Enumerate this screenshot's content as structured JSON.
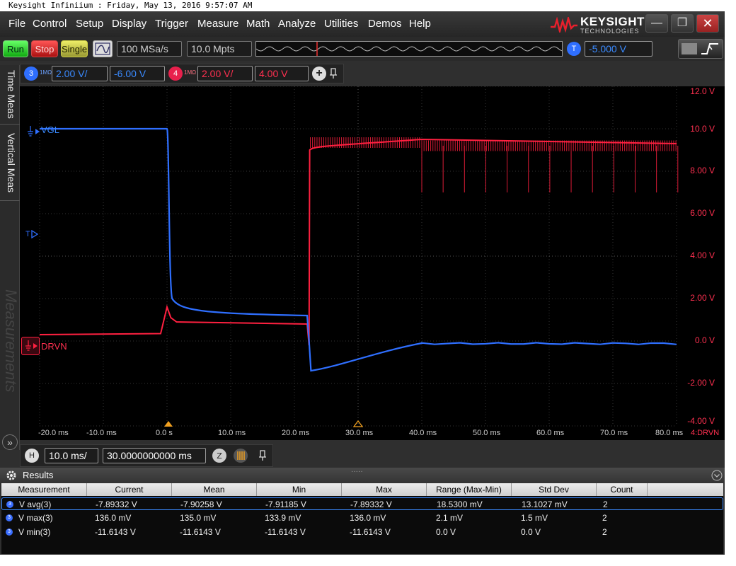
{
  "title_bar": "Keysight Infiniium : Friday, May 13, 2016 9:57:07 AM",
  "menu": [
    "File",
    "Control",
    "Setup",
    "Display",
    "Trigger",
    "Measure",
    "Math",
    "Analyze",
    "Utilities",
    "Demos",
    "Help"
  ],
  "logo": {
    "name": "KEYSIGHT",
    "sub": "TECHNOLOGIES"
  },
  "window_buttons": {
    "minimize": "—",
    "maximize": "❐",
    "close": "✕"
  },
  "toolbar": {
    "run": "Run",
    "stop": "Stop",
    "single": "Single",
    "sample_rate": "100 MSa/s",
    "memory_depth": "10.0 Mpts",
    "trigger_badge": "T",
    "trigger_level": "-5.000 V"
  },
  "channels": {
    "ch3": {
      "number": "3",
      "impedance": "1MΩ",
      "scale": "2.00 V/",
      "offset": "-6.00 V",
      "color": "#2f6fff"
    },
    "ch4": {
      "number": "4",
      "impedance": "1MΩ",
      "scale": "2.00 V/",
      "offset": "4.00 V",
      "color": "#ff2040"
    },
    "add": "+"
  },
  "side_tabs": {
    "time_meas": "Time Meas",
    "vertical_meas": "Vertical Meas",
    "measurements": "Measurements"
  },
  "plot": {
    "ch3_label": "VGL",
    "ch4_label": "DRVN",
    "trigger_marker": "T",
    "x_ticks": [
      "-20.0 ms",
      "-10.0 ms",
      "0.0 s",
      "10.0 ms",
      "20.0 ms",
      "30.0 ms",
      "40.0 ms",
      "50.0 ms",
      "60.0 ms",
      "70.0 ms",
      "80.0 ms"
    ],
    "x_axis_source": "4:DRVN",
    "y_ticks": [
      "12.0 V",
      "10.0 V",
      "8.00 V",
      "6.00 V",
      "4.00 V",
      "2.00 V",
      "0.0 V",
      "-2.00 V",
      "-4.00 V"
    ]
  },
  "horizontal": {
    "badge": "H",
    "scale": "10.0 ms/",
    "position": "30.0000000000 ms"
  },
  "results": {
    "title": "Results",
    "columns": [
      "Measurement",
      "Current",
      "Mean",
      "Min",
      "Max",
      "Range (Max-Min)",
      "Std Dev",
      "Count"
    ],
    "rows": [
      {
        "badge": "3",
        "name": "V avg(3)",
        "current": "-7.89332 V",
        "mean": "-7.90258 V",
        "min": "-7.91185 V",
        "max": "-7.89332 V",
        "range": "18.5300 mV",
        "std": "13.1027 mV",
        "count": "2"
      },
      {
        "badge": "3",
        "name": "V max(3)",
        "current": "136.0 mV",
        "mean": "135.0 mV",
        "min": "133.9 mV",
        "max": "136.0 mV",
        "range": "2.1 mV",
        "std": "1.5 mV",
        "count": "2"
      },
      {
        "badge": "3",
        "name": "V min(3)",
        "current": "-11.6143 V",
        "mean": "-11.6143 V",
        "min": "-11.6143 V",
        "max": "-11.6143 V",
        "range": "0.0 V",
        "std": "0.0 V",
        "count": "2"
      }
    ]
  }
}
